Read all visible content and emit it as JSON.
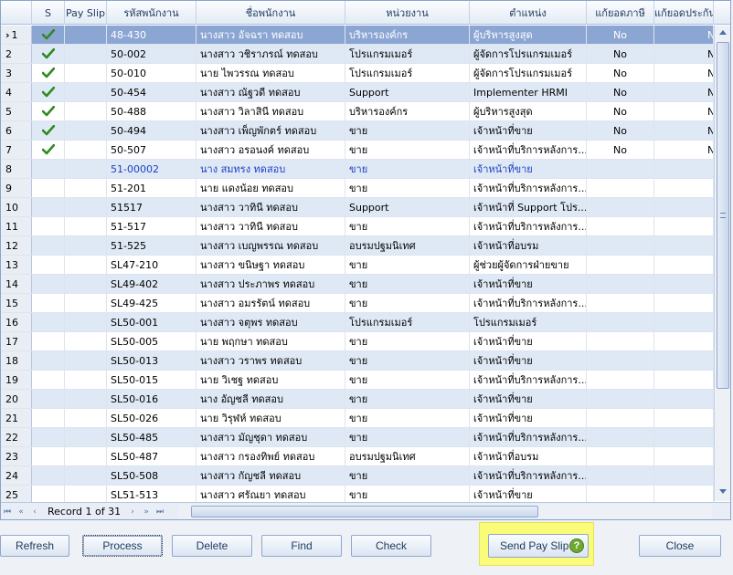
{
  "grid": {
    "columns": [
      {
        "key": "ind",
        "label": ""
      },
      {
        "key": "s",
        "label": "S"
      },
      {
        "key": "payslip",
        "label": "Pay Slip"
      },
      {
        "key": "code",
        "label": "รหัสพนักงาน"
      },
      {
        "key": "name",
        "label": "ชื่อพนักงาน"
      },
      {
        "key": "unit",
        "label": "หน่วยงาน"
      },
      {
        "key": "pos",
        "label": "ตำแหน่ง"
      },
      {
        "key": "tax",
        "label": "แก้ยอดภาษี"
      },
      {
        "key": "ss",
        "label": "แก้ยอดประกัน"
      }
    ],
    "rows": [
      {
        "num": "1",
        "s": true,
        "code": "48-430",
        "name": "นางสาว อัจฉรา ทดสอบ",
        "unit": "บริหารองค์กร",
        "pos": "ผู้บริหารสูงสุด",
        "tax": "No",
        "ss": "No"
      },
      {
        "num": "2",
        "s": true,
        "code": "50-002",
        "name": "นางสาว วชิราภรณ์ ทดสอบ",
        "unit": "โปรแกรมเมอร์",
        "pos": "ผู้จัดการโปรแกรมเมอร์",
        "tax": "No",
        "ss": "No"
      },
      {
        "num": "3",
        "s": true,
        "code": "50-010",
        "name": "นาย ไพวรรณ ทดสอบ",
        "unit": "โปรแกรมเมอร์",
        "pos": "ผู้จัดการโปรแกรมเมอร์",
        "tax": "No",
        "ss": "No"
      },
      {
        "num": "4",
        "s": true,
        "code": "50-454",
        "name": "นางสาว ณัฐวดี ทดสอบ",
        "unit": "Support",
        "pos": "Implementer HRMI",
        "tax": "No",
        "ss": "No"
      },
      {
        "num": "5",
        "s": true,
        "code": "50-488",
        "name": "นางสาว วิลาสินี ทดสอบ",
        "unit": "บริหารองค์กร",
        "pos": "ผู้บริหารสูงสุด",
        "tax": "No",
        "ss": "No"
      },
      {
        "num": "6",
        "s": true,
        "code": "50-494",
        "name": "นางสาว เพ็ญพักตร์ ทดสอบ",
        "unit": "ขาย",
        "pos": "เจ้าหน้าที่ขาย",
        "tax": "No",
        "ss": "No"
      },
      {
        "num": "7",
        "s": true,
        "code": "50-507",
        "name": "นางสาว อรอนงค์ ทดสอบ",
        "unit": "ขาย",
        "pos": "เจ้าหน้าที่บริการหลังการ...",
        "tax": "No",
        "ss": "No"
      },
      {
        "num": "8",
        "s": false,
        "code": "51-00002",
        "name": "นาง สมทรง ทดสอบ",
        "unit": "ขาย",
        "pos": "เจ้าหน้าที่ขาย",
        "tax": "",
        "ss": ""
      },
      {
        "num": "9",
        "s": false,
        "code": "51-201",
        "name": "นาย แดงน้อย ทดสอบ",
        "unit": "ขาย",
        "pos": "เจ้าหน้าที่บริการหลังการ...",
        "tax": "",
        "ss": ""
      },
      {
        "num": "10",
        "s": false,
        "code": "51517",
        "name": "นางสาว วาทินี ทดสอบ",
        "unit": "Support",
        "pos": "เจ้าหน้าที่ Support โปร...",
        "tax": "",
        "ss": ""
      },
      {
        "num": "11",
        "s": false,
        "code": "51-517",
        "name": "นางสาว วาทินี ทดสอบ",
        "unit": "ขาย",
        "pos": "เจ้าหน้าที่บริการหลังการ...",
        "tax": "",
        "ss": ""
      },
      {
        "num": "12",
        "s": false,
        "code": "51-525",
        "name": "นางสาว เบญพรรณ ทดสอบ",
        "unit": "อบรมปฐมนิเทศ",
        "pos": "เจ้าหน้าที่อบรม",
        "tax": "",
        "ss": ""
      },
      {
        "num": "13",
        "s": false,
        "code": "SL47-210",
        "name": "นางสาว ขนิษฐา ทดสอบ",
        "unit": "ขาย",
        "pos": "ผู้ช่วยผู้จัดการฝ่ายขาย",
        "tax": "",
        "ss": ""
      },
      {
        "num": "14",
        "s": false,
        "code": "SL49-402",
        "name": "นางสาว ประภาพร ทดสอบ",
        "unit": "ขาย",
        "pos": "เจ้าหน้าที่ขาย",
        "tax": "",
        "ss": ""
      },
      {
        "num": "15",
        "s": false,
        "code": "SL49-425",
        "name": "นางสาว อมรรัตน์ ทดสอบ",
        "unit": "ขาย",
        "pos": "เจ้าหน้าที่บริการหลังการ...",
        "tax": "",
        "ss": ""
      },
      {
        "num": "16",
        "s": false,
        "code": "SL50-001",
        "name": "นางสาว จตุพร ทดสอบ",
        "unit": "โปรแกรมเมอร์",
        "pos": "โปรแกรมเมอร์",
        "tax": "",
        "ss": ""
      },
      {
        "num": "17",
        "s": false,
        "code": "SL50-005",
        "name": "นาย พฤกษา ทดสอบ",
        "unit": "ขาย",
        "pos": "เจ้าหน้าที่ขาย",
        "tax": "",
        "ss": ""
      },
      {
        "num": "18",
        "s": false,
        "code": "SL50-013",
        "name": "นางสาว วราพร ทดสอบ",
        "unit": "ขาย",
        "pos": "เจ้าหน้าที่ขาย",
        "tax": "",
        "ss": ""
      },
      {
        "num": "19",
        "s": false,
        "code": "SL50-015",
        "name": "นาย วิเชฐ ทดสอบ",
        "unit": "ขาย",
        "pos": "เจ้าหน้าที่บริการหลังการ...",
        "tax": "",
        "ss": ""
      },
      {
        "num": "20",
        "s": false,
        "code": "SL50-016",
        "name": "นาง อัญชลี ทดสอบ",
        "unit": "ขาย",
        "pos": "เจ้าหน้าที่ขาย",
        "tax": "",
        "ss": ""
      },
      {
        "num": "21",
        "s": false,
        "code": "SL50-026",
        "name": "นาย วิรุฬห์ ทดสอบ",
        "unit": "ขาย",
        "pos": "เจ้าหน้าที่ขาย",
        "tax": "",
        "ss": ""
      },
      {
        "num": "22",
        "s": false,
        "code": "SL50-485",
        "name": "นางสาว มัญชุดา ทดสอบ",
        "unit": "ขาย",
        "pos": "เจ้าหน้าที่บริการหลังการ...",
        "tax": "",
        "ss": ""
      },
      {
        "num": "23",
        "s": false,
        "code": "SL50-487",
        "name": "นางสาว กรองทิพย์ ทดสอบ",
        "unit": "อบรมปฐมนิเทศ",
        "pos": "เจ้าหน้าที่อบรม",
        "tax": "",
        "ss": ""
      },
      {
        "num": "24",
        "s": false,
        "code": "SL50-508",
        "name": "นางสาว กัญชลี ทดสอบ",
        "unit": "ขาย",
        "pos": "เจ้าหน้าที่บริการหลังการ...",
        "tax": "",
        "ss": ""
      },
      {
        "num": "25",
        "s": false,
        "code": "SL51-513",
        "name": "นางสาว ศรัณยา ทดสอบ",
        "unit": "ขาย",
        "pos": "เจ้าหน้าที่ขาย",
        "tax": "",
        "ss": ""
      }
    ]
  },
  "navigator": {
    "record_text": "Record 1 of 31",
    "first_icon": "first-record-icon",
    "prev_page_icon": "previous-page-icon",
    "prev_icon": "previous-record-icon",
    "next_icon": "next-record-icon",
    "next_page_icon": "next-page-icon",
    "last_icon": "last-record-icon"
  },
  "buttons": {
    "refresh": "Refresh",
    "process": "Process",
    "delete": "Delete",
    "find": "Find",
    "check": "Check",
    "send_pay_slip": "Send Pay Slip",
    "help": "?",
    "close": "Close"
  },
  "colors": {
    "selected_row": "#8ca6d3",
    "alt_row": "#dfe9f5",
    "focus_row_text": "#1c3fc4",
    "highlight": "#fbfb7a",
    "check": "#2f8a1f"
  }
}
